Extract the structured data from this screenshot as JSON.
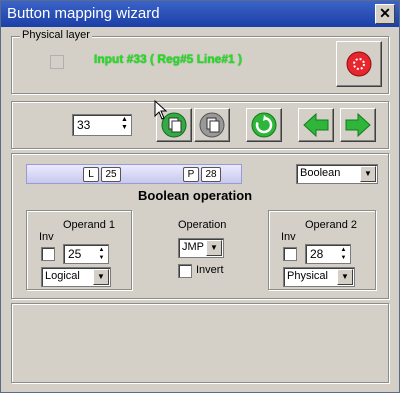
{
  "window": {
    "title": "Button mapping wizard"
  },
  "physical_layer": {
    "legend": "Physical layer",
    "input_text": "Input #33  ( Reg#5  Line#1 )"
  },
  "toolbar": {
    "input_number": "33"
  },
  "boolean_panel": {
    "left_tag": "L",
    "left_value": "25",
    "right_tag": "P",
    "right_value": "28",
    "mode": "Boolean",
    "heading": "Boolean operation"
  },
  "operand1": {
    "inv_label": "Inv",
    "title": "Operand 1",
    "value": "25",
    "type": "Logical"
  },
  "operation": {
    "title": "Operation",
    "value": "JMP",
    "invert_label": "Invert"
  },
  "operand2": {
    "inv_label": "Inv",
    "title": "Operand 2",
    "value": "28",
    "type": "Physical"
  },
  "colors": {
    "accent_green": "#21e221",
    "title_blue": "#1b3fa6",
    "stop_red": "#e8262e"
  }
}
